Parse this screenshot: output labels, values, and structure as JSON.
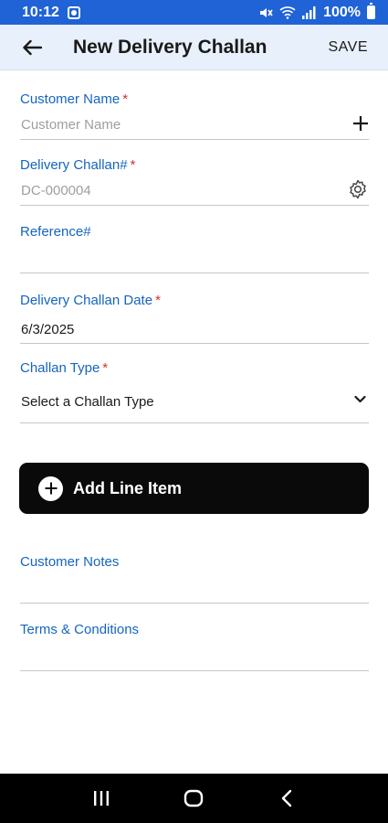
{
  "status_bar": {
    "time": "10:12",
    "battery": "100%"
  },
  "app_bar": {
    "title": "New Delivery Challan",
    "save_label": "SAVE"
  },
  "form": {
    "customer_name": {
      "label": "Customer Name",
      "required": "*",
      "placeholder": "Customer Name"
    },
    "delivery_challan": {
      "label": "Delivery Challan#",
      "required": "*",
      "placeholder": "DC-000004"
    },
    "reference": {
      "label": "Reference#"
    },
    "challan_date": {
      "label": "Delivery Challan Date",
      "required": "*",
      "value": "6/3/2025"
    },
    "challan_type": {
      "label": "Challan Type",
      "required": "*",
      "value": "Select a Challan Type"
    },
    "add_line_item": {
      "label": "Add Line Item"
    },
    "customer_notes": {
      "label": "Customer Notes"
    },
    "terms": {
      "label": "Terms & Conditions"
    }
  },
  "colors": {
    "status_bar": "#1f63d6",
    "app_bar": "#e8f0fb",
    "label": "#1565c0",
    "required": "#d32f2f",
    "button": "#0a0a0a"
  },
  "icons": [
    "mute-icon",
    "wifi-icon",
    "signal-icon",
    "battery-icon",
    "back-arrow-icon",
    "plus-icon",
    "gear-icon",
    "chevron-down-icon",
    "recents-icon",
    "home-icon",
    "back-icon"
  ]
}
